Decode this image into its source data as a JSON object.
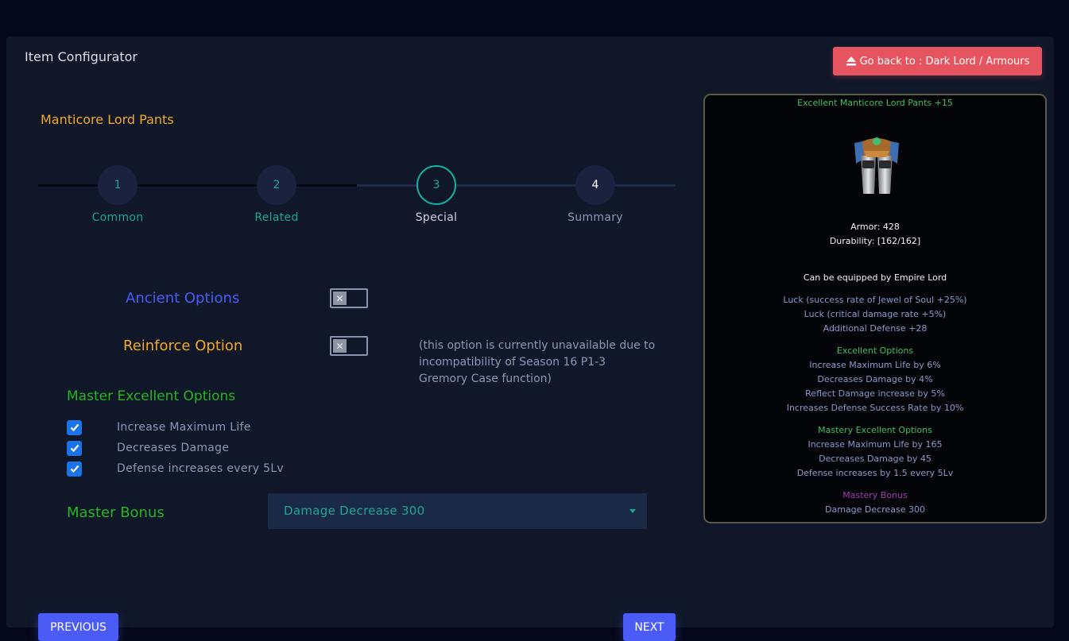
{
  "panel": {
    "title": "Item Configurator",
    "back_button": "Go back to : Dark Lord / Armours"
  },
  "item": {
    "name": "Manticore Lord Pants"
  },
  "stepper": {
    "steps": [
      {
        "num": "1",
        "label": "Common",
        "state": "done"
      },
      {
        "num": "2",
        "label": "Related",
        "state": "done"
      },
      {
        "num": "3",
        "label": "Special",
        "state": "active"
      },
      {
        "num": "4",
        "label": "Summary",
        "state": "pending"
      }
    ]
  },
  "options": {
    "ancient_label": "Ancient Options",
    "ancient_enabled": false,
    "reinforce_label": "Reinforce Option",
    "reinforce_enabled": false,
    "reinforce_note": "(this option is currently unavailable due to incompatibility of Season 16 P1-3 Gremory Case function)",
    "ancient_color": "#4a5cf5",
    "reinforce_color": "#f2a82c"
  },
  "master_excellent": {
    "title": "Master Excellent Options",
    "items": [
      {
        "label": "Increase Maximum Life",
        "checked": true
      },
      {
        "label": "Decreases Damage",
        "checked": true
      },
      {
        "label": "Defense increases every 5Lv",
        "checked": true
      }
    ]
  },
  "master_bonus": {
    "label": "Master Bonus",
    "selected": "Damage Decrease 300"
  },
  "nav": {
    "previous": "PREVIOUS",
    "next": "NEXT"
  },
  "tooltip": {
    "title": "Excellent Manticore Lord Pants +15",
    "armor": "Armor: 428",
    "durability": "Durability: [162/162]",
    "equip": "Can be equipped by Empire Lord",
    "luck1": "Luck (success rate of Jewel of Soul +25%)",
    "luck2": "Luck (critical damage rate +5%)",
    "additional": "Additional Defense +28",
    "excellent_title": "Excellent Options",
    "excellent": [
      "Increase Maximum Life by 6%",
      "Decreases Damage by 4%",
      "Reflect Damage increase by 5%",
      "Increases Defense Success Rate by 10%"
    ],
    "mastery_title": "Mastery Excellent Options",
    "mastery": [
      "Increase Maximum Life by 165",
      "Decreases Damage by 45",
      "Defense increases by 1.5 every 5Lv"
    ],
    "bonus_title": "Mastery Bonus",
    "bonus": "Damage Decrease 300"
  }
}
